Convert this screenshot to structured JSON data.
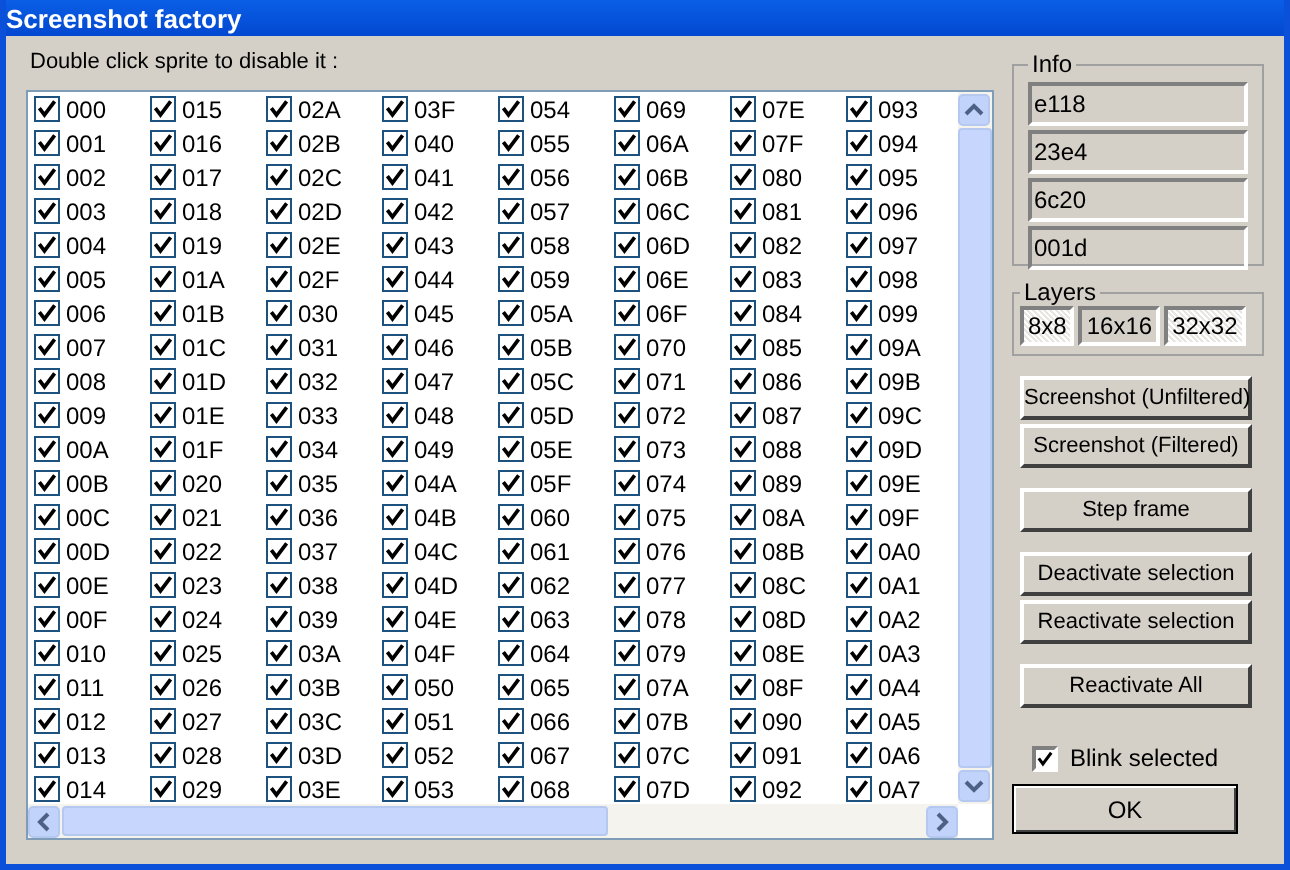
{
  "window": {
    "title": "Screenshot factory"
  },
  "instruction": "Double click sprite to disable it :",
  "sprites": [
    {
      "label": "000",
      "checked": true
    },
    {
      "label": "001",
      "checked": true
    },
    {
      "label": "002",
      "checked": true
    },
    {
      "label": "003",
      "checked": true
    },
    {
      "label": "004",
      "checked": true
    },
    {
      "label": "005",
      "checked": true
    },
    {
      "label": "006",
      "checked": true
    },
    {
      "label": "007",
      "checked": true
    },
    {
      "label": "008",
      "checked": true
    },
    {
      "label": "009",
      "checked": true
    },
    {
      "label": "00A",
      "checked": true
    },
    {
      "label": "00B",
      "checked": true
    },
    {
      "label": "00C",
      "checked": true
    },
    {
      "label": "00D",
      "checked": true
    },
    {
      "label": "00E",
      "checked": true
    },
    {
      "label": "00F",
      "checked": true
    },
    {
      "label": "010",
      "checked": true
    },
    {
      "label": "011",
      "checked": true
    },
    {
      "label": "012",
      "checked": true
    },
    {
      "label": "013",
      "checked": true
    },
    {
      "label": "014",
      "checked": true
    },
    {
      "label": "015",
      "checked": true
    },
    {
      "label": "016",
      "checked": true
    },
    {
      "label": "017",
      "checked": true
    },
    {
      "label": "018",
      "checked": true
    },
    {
      "label": "019",
      "checked": true
    },
    {
      "label": "01A",
      "checked": true
    },
    {
      "label": "01B",
      "checked": true
    },
    {
      "label": "01C",
      "checked": true
    },
    {
      "label": "01D",
      "checked": true
    },
    {
      "label": "01E",
      "checked": true
    },
    {
      "label": "01F",
      "checked": true
    },
    {
      "label": "020",
      "checked": true
    },
    {
      "label": "021",
      "checked": true
    },
    {
      "label": "022",
      "checked": true
    },
    {
      "label": "023",
      "checked": true
    },
    {
      "label": "024",
      "checked": true
    },
    {
      "label": "025",
      "checked": true
    },
    {
      "label": "026",
      "checked": true
    },
    {
      "label": "027",
      "checked": true
    },
    {
      "label": "028",
      "checked": true
    },
    {
      "label": "029",
      "checked": true
    },
    {
      "label": "02A",
      "checked": true
    },
    {
      "label": "02B",
      "checked": true
    },
    {
      "label": "02C",
      "checked": true
    },
    {
      "label": "02D",
      "checked": true
    },
    {
      "label": "02E",
      "checked": true
    },
    {
      "label": "02F",
      "checked": true
    },
    {
      "label": "030",
      "checked": true
    },
    {
      "label": "031",
      "checked": true
    },
    {
      "label": "032",
      "checked": true
    },
    {
      "label": "033",
      "checked": true
    },
    {
      "label": "034",
      "checked": true
    },
    {
      "label": "035",
      "checked": true
    },
    {
      "label": "036",
      "checked": true
    },
    {
      "label": "037",
      "checked": true
    },
    {
      "label": "038",
      "checked": true
    },
    {
      "label": "039",
      "checked": true
    },
    {
      "label": "03A",
      "checked": true
    },
    {
      "label": "03B",
      "checked": true
    },
    {
      "label": "03C",
      "checked": true
    },
    {
      "label": "03D",
      "checked": true
    },
    {
      "label": "03E",
      "checked": true
    },
    {
      "label": "03F",
      "checked": true
    },
    {
      "label": "040",
      "checked": true
    },
    {
      "label": "041",
      "checked": true
    },
    {
      "label": "042",
      "checked": true
    },
    {
      "label": "043",
      "checked": true
    },
    {
      "label": "044",
      "checked": true
    },
    {
      "label": "045",
      "checked": true
    },
    {
      "label": "046",
      "checked": true
    },
    {
      "label": "047",
      "checked": true
    },
    {
      "label": "048",
      "checked": true
    },
    {
      "label": "049",
      "checked": true
    },
    {
      "label": "04A",
      "checked": true
    },
    {
      "label": "04B",
      "checked": true
    },
    {
      "label": "04C",
      "checked": true
    },
    {
      "label": "04D",
      "checked": true
    },
    {
      "label": "04E",
      "checked": true
    },
    {
      "label": "04F",
      "checked": true
    },
    {
      "label": "050",
      "checked": true
    },
    {
      "label": "051",
      "checked": true
    },
    {
      "label": "052",
      "checked": true
    },
    {
      "label": "053",
      "checked": true
    },
    {
      "label": "054",
      "checked": true
    },
    {
      "label": "055",
      "checked": true
    },
    {
      "label": "056",
      "checked": true
    },
    {
      "label": "057",
      "checked": true
    },
    {
      "label": "058",
      "checked": true
    },
    {
      "label": "059",
      "checked": true
    },
    {
      "label": "05A",
      "checked": true
    },
    {
      "label": "05B",
      "checked": true
    },
    {
      "label": "05C",
      "checked": true
    },
    {
      "label": "05D",
      "checked": true
    },
    {
      "label": "05E",
      "checked": true
    },
    {
      "label": "05F",
      "checked": true
    },
    {
      "label": "060",
      "checked": true
    },
    {
      "label": "061",
      "checked": true
    },
    {
      "label": "062",
      "checked": true
    },
    {
      "label": "063",
      "checked": true
    },
    {
      "label": "064",
      "checked": true
    },
    {
      "label": "065",
      "checked": true
    },
    {
      "label": "066",
      "checked": true
    },
    {
      "label": "067",
      "checked": true
    },
    {
      "label": "068",
      "checked": true
    },
    {
      "label": "069",
      "checked": true
    },
    {
      "label": "06A",
      "checked": true
    },
    {
      "label": "06B",
      "checked": true
    },
    {
      "label": "06C",
      "checked": true
    },
    {
      "label": "06D",
      "checked": true
    },
    {
      "label": "06E",
      "checked": true
    },
    {
      "label": "06F",
      "checked": true
    },
    {
      "label": "070",
      "checked": true
    },
    {
      "label": "071",
      "checked": true
    },
    {
      "label": "072",
      "checked": true
    },
    {
      "label": "073",
      "checked": true
    },
    {
      "label": "074",
      "checked": true
    },
    {
      "label": "075",
      "checked": true
    },
    {
      "label": "076",
      "checked": true
    },
    {
      "label": "077",
      "checked": true
    },
    {
      "label": "078",
      "checked": true
    },
    {
      "label": "079",
      "checked": true
    },
    {
      "label": "07A",
      "checked": true
    },
    {
      "label": "07B",
      "checked": true
    },
    {
      "label": "07C",
      "checked": true
    },
    {
      "label": "07D",
      "checked": true
    },
    {
      "label": "07E",
      "checked": true
    },
    {
      "label": "07F",
      "checked": true
    },
    {
      "label": "080",
      "checked": true
    },
    {
      "label": "081",
      "checked": true
    },
    {
      "label": "082",
      "checked": true
    },
    {
      "label": "083",
      "checked": true
    },
    {
      "label": "084",
      "checked": true
    },
    {
      "label": "085",
      "checked": true
    },
    {
      "label": "086",
      "checked": true
    },
    {
      "label": "087",
      "checked": true
    },
    {
      "label": "088",
      "checked": true
    },
    {
      "label": "089",
      "checked": true
    },
    {
      "label": "08A",
      "checked": true
    },
    {
      "label": "08B",
      "checked": true
    },
    {
      "label": "08C",
      "checked": true
    },
    {
      "label": "08D",
      "checked": true
    },
    {
      "label": "08E",
      "checked": true
    },
    {
      "label": "08F",
      "checked": true
    },
    {
      "label": "090",
      "checked": true
    },
    {
      "label": "091",
      "checked": true
    },
    {
      "label": "092",
      "checked": true
    },
    {
      "label": "093",
      "checked": true
    },
    {
      "label": "094",
      "checked": true
    },
    {
      "label": "095",
      "checked": true
    },
    {
      "label": "096",
      "checked": true
    },
    {
      "label": "097",
      "checked": true
    },
    {
      "label": "098",
      "checked": true
    },
    {
      "label": "099",
      "checked": true
    },
    {
      "label": "09A",
      "checked": true
    },
    {
      "label": "09B",
      "checked": true
    },
    {
      "label": "09C",
      "checked": true
    },
    {
      "label": "09D",
      "checked": true
    },
    {
      "label": "09E",
      "checked": true
    },
    {
      "label": "09F",
      "checked": true
    },
    {
      "label": "0A0",
      "checked": true
    },
    {
      "label": "0A1",
      "checked": true
    },
    {
      "label": "0A2",
      "checked": true
    },
    {
      "label": "0A3",
      "checked": true
    },
    {
      "label": "0A4",
      "checked": true
    },
    {
      "label": "0A5",
      "checked": true
    },
    {
      "label": "0A6",
      "checked": true
    },
    {
      "label": "0A7",
      "checked": true
    }
  ],
  "info": {
    "title": "Info",
    "fields": [
      "e118",
      "23e4",
      "6c20",
      "001d"
    ]
  },
  "layers": {
    "title": "Layers",
    "buttons": [
      {
        "label": "8x8",
        "checked": true
      },
      {
        "label": "16x16",
        "checked": false
      },
      {
        "label": "32x32",
        "checked": true
      }
    ]
  },
  "actions": [
    {
      "label": "Screenshot (Unfiltered)"
    },
    {
      "label": "Screenshot (Filtered)"
    },
    {
      "label": "Step frame"
    },
    {
      "label": "Deactivate selection"
    },
    {
      "label": "Reactivate selection"
    },
    {
      "label": "Reactivate All"
    }
  ],
  "blink": {
    "label": "Blink selected",
    "checked": true
  },
  "ok": "OK"
}
